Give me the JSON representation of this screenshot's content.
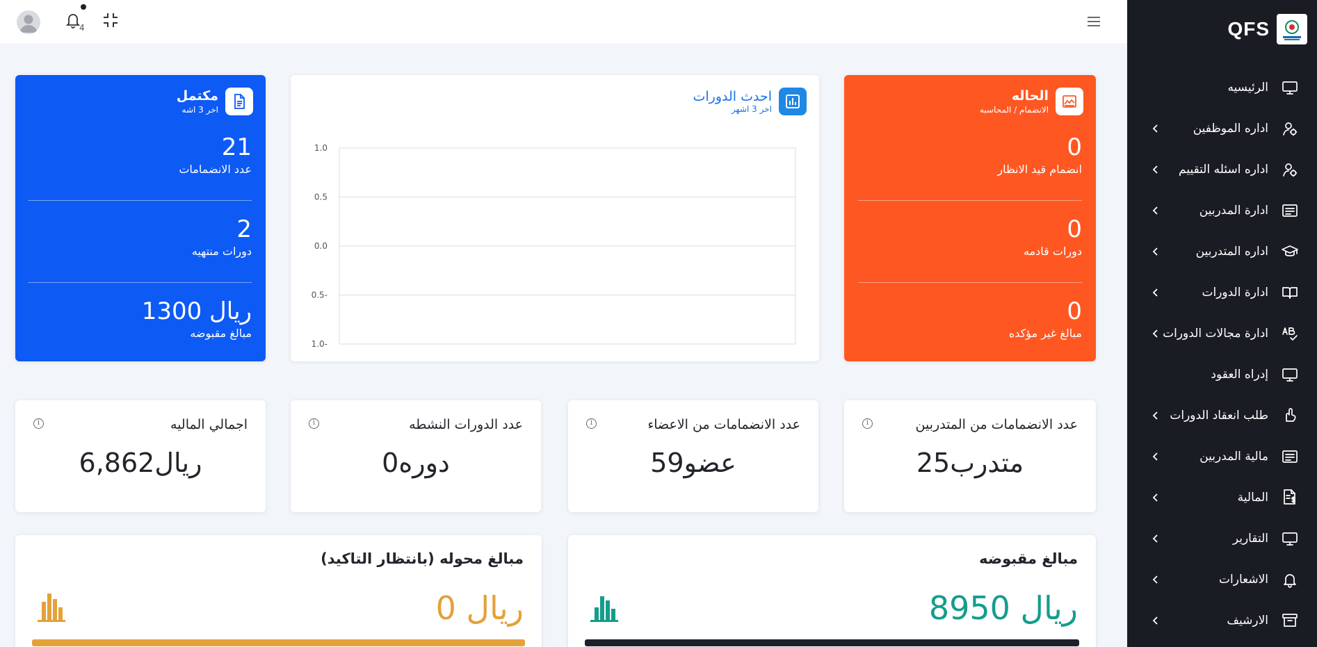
{
  "brand": {
    "name": "QFS"
  },
  "topbar": {
    "notification_count": "4"
  },
  "sidebar": {
    "items": [
      {
        "label": "الرئيسيه",
        "icon": "monitor-icon",
        "has_children": false
      },
      {
        "label": "اداره الموظفين",
        "icon": "users-icon",
        "has_children": true
      },
      {
        "label": "اداره اسئله التقييم",
        "icon": "users-icon",
        "has_children": true
      },
      {
        "label": "ادارة المدربين",
        "icon": "id-card-icon",
        "has_children": true
      },
      {
        "label": "اداره المتدربين",
        "icon": "graduation-cap-icon",
        "has_children": true
      },
      {
        "label": "ادارة الدورات",
        "icon": "book-icon",
        "has_children": true
      },
      {
        "label": "ادارة مجالات الدورات",
        "icon": "ab-check-icon",
        "has_children": true
      },
      {
        "label": "إدراه العقود",
        "icon": "monitor-icon",
        "has_children": false
      },
      {
        "label": "طلب انعقاد الدورات",
        "icon": "hand-icon",
        "has_children": true
      },
      {
        "label": "مالية المدربين",
        "icon": "id-card-icon",
        "has_children": true
      },
      {
        "label": "المالية",
        "icon": "invoice-icon",
        "has_children": true
      },
      {
        "label": "التقارير",
        "icon": "monitor-icon",
        "has_children": true
      },
      {
        "label": "الاشعارات",
        "icon": "bell-icon",
        "has_children": true
      },
      {
        "label": "الارشيف",
        "icon": "archive-icon",
        "has_children": true
      }
    ]
  },
  "card_complete": {
    "title": "مكتمل",
    "subtitle": "اخر 3 اشه",
    "stats": [
      {
        "value": "21",
        "label": "عدد الانضمامات"
      },
      {
        "value": "2",
        "label": "دورات منتهيه"
      },
      {
        "value": "1300 ريال",
        "label": "مبالغ مقبوضه"
      }
    ]
  },
  "card_chart": {
    "title": "احدث الدورات",
    "subtitle": "اخر 3 اشهر"
  },
  "chart_data": {
    "type": "line",
    "title": "",
    "xlabel": "",
    "ylabel": "",
    "series": [],
    "y_ticks": [
      "1.0",
      "0.5",
      "0.0",
      "0.5-",
      "1.0-"
    ],
    "ylim": [
      -1,
      1
    ],
    "grid": true
  },
  "card_status": {
    "title": "الحاله",
    "subtitle": "الانضمام / المحاسبه",
    "stats": [
      {
        "value": "0",
        "label": "انضمام قيد الانظار"
      },
      {
        "value": "0",
        "label": "دورات قادمه"
      },
      {
        "value": "0",
        "label": "مبالغ غير مؤكده"
      }
    ]
  },
  "metrics": [
    {
      "title": "عدد الانضمامات من المتدربين",
      "value": "25متدرب"
    },
    {
      "title": "عدد الانضمامات من الاعضاء",
      "value": "59عضو"
    },
    {
      "title": "عدد الدورات النشطه",
      "value": "0دوره"
    },
    {
      "title": "اجمالي الماليه",
      "value": "6,862ريال"
    }
  ],
  "received": {
    "title": "مبالغ مقبوضه",
    "value": "8950 ريال",
    "color": "#149d8c"
  },
  "pending": {
    "title": "مبالغ محوله (بانتظار التاكيد)",
    "value": "0 ريال",
    "color": "#e4a13a"
  },
  "colors": {
    "blue": "#0d5af5",
    "orange": "#ff5722",
    "sidebar": "#1a1c23",
    "accent": "#1e88e5"
  }
}
